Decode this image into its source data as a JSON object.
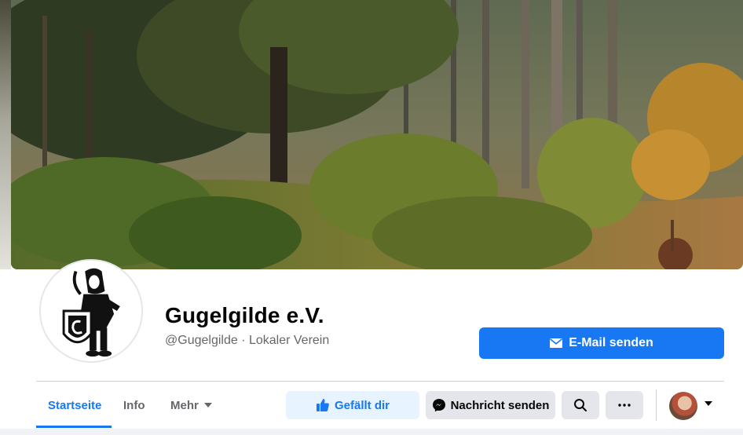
{
  "page": {
    "name": "Gugelgilde e.V.",
    "handle_category": "@Gugelgilde · Lokaler Verein"
  },
  "cover_photo": {
    "icon": "forest-cover-photo"
  },
  "profile_picture": {
    "icon": "knight-shield-logo"
  },
  "buttons": {
    "email": {
      "label": "E-Mail senden",
      "icon": "envelope-icon"
    },
    "like": {
      "label": "Gefällt dir",
      "icon": "thumbs-up-icon"
    },
    "message": {
      "label": "Nachricht senden",
      "icon": "messenger-icon"
    },
    "search": {
      "icon": "search-icon"
    },
    "more": {
      "icon": "more-dots-icon"
    }
  },
  "tabs": [
    {
      "label": "Startseite",
      "active": true
    },
    {
      "label": "Info",
      "active": false
    },
    {
      "label": "Mehr",
      "active": false,
      "icon": "caret-down-icon"
    }
  ],
  "account": {
    "icon": "user-avatar",
    "menu_icon": "caret-down-icon"
  },
  "colors": {
    "accent": "#1877f2",
    "like_bg": "#e7f3ff",
    "secondary_bg": "#e4e6eb",
    "muted_text": "#65676b"
  }
}
